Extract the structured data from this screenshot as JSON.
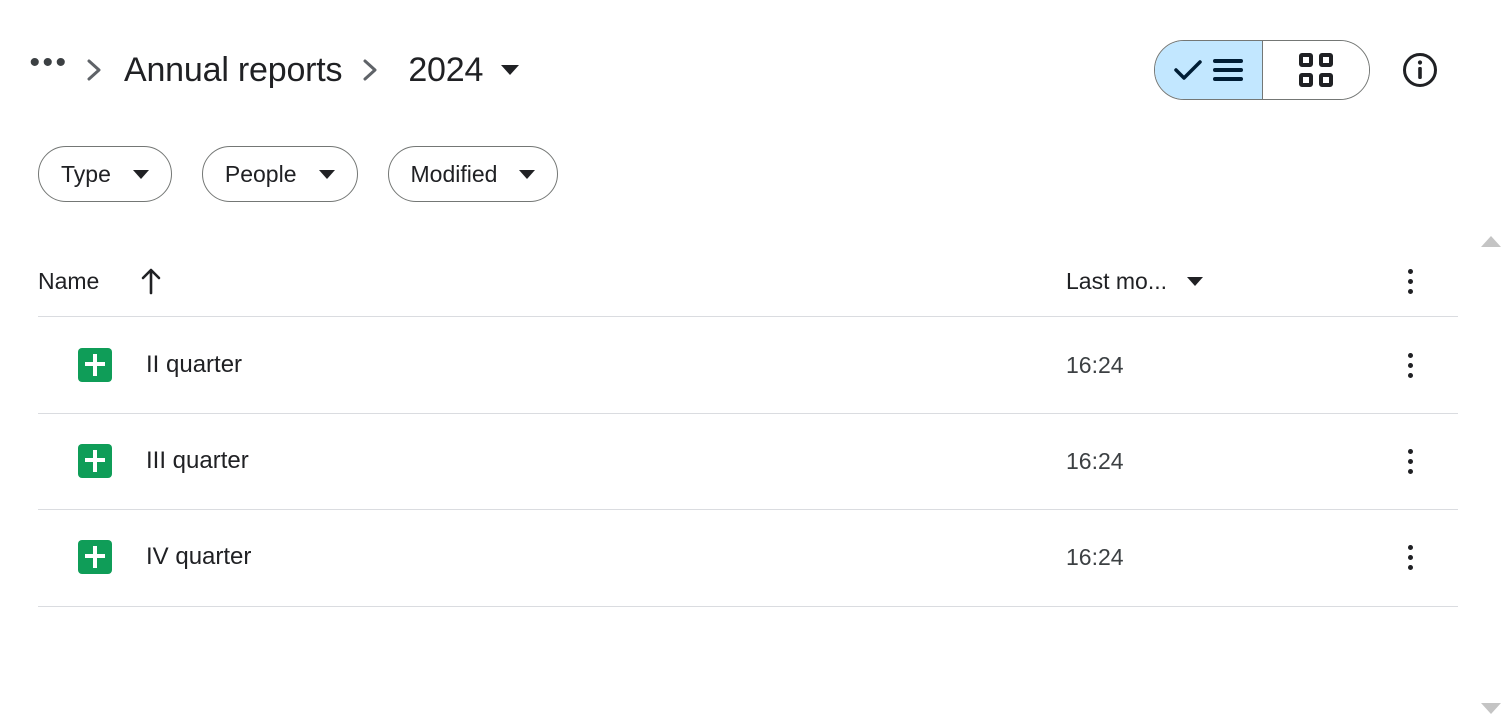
{
  "breadcrumb": {
    "overflow_label": "•••",
    "parent_label": "Annual reports",
    "current_label": "2024"
  },
  "view_toggle": {
    "list_selected": true,
    "list_label": "List view",
    "grid_label": "Grid view",
    "selected_bg": "#c2e7ff",
    "border_color": "#747775"
  },
  "info_button": {
    "label": "View details"
  },
  "filters": [
    {
      "label": "Type"
    },
    {
      "label": "People"
    },
    {
      "label": "Modified"
    }
  ],
  "table": {
    "columns": {
      "name": "Name",
      "sort_direction": "ascending",
      "modified": "Last mo..."
    },
    "rows": [
      {
        "name": "II quarter",
        "icon": "google-sheets-icon",
        "modified": "16:24"
      },
      {
        "name": "III quarter",
        "icon": "google-sheets-icon",
        "modified": "16:24"
      },
      {
        "name": "IV quarter",
        "icon": "google-sheets-icon",
        "modified": "16:24"
      }
    ]
  },
  "colors": {
    "sheets_green": "#0f9d58",
    "divider": "#dadce0",
    "text_primary": "#202124",
    "scrollbar_arrow": "#c4c4c4"
  }
}
